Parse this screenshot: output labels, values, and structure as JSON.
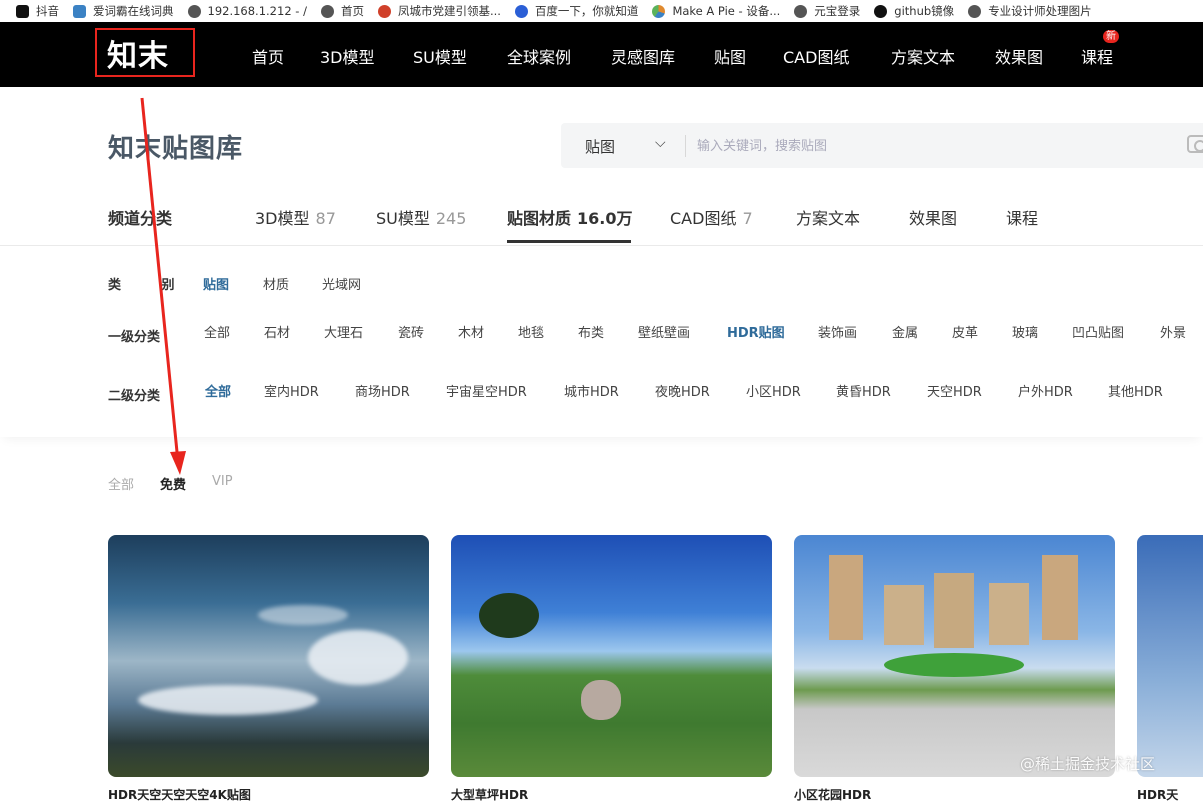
{
  "bookmarks": [
    {
      "label": "抖音",
      "color": "#111111"
    },
    {
      "label": "爱词霸在线词典",
      "color": "#3b82c4"
    },
    {
      "label": "192.168.1.212 - /",
      "color": "#333333"
    },
    {
      "label": "首页",
      "color": "#444444"
    },
    {
      "label": "凤城市党建引领基...",
      "color": "#d0402a"
    },
    {
      "label": "百度一下，你就知道",
      "color": "#2b5fd6"
    },
    {
      "label": "Make A Pie - 设备...",
      "color": "#e08a2f"
    },
    {
      "label": "元宝登录",
      "color": "#444444"
    },
    {
      "label": "github镜像",
      "color": "#111111"
    },
    {
      "label": "专业设计师处理图片",
      "color": "#555555"
    }
  ],
  "navbar": {
    "logo": "知末",
    "items": [
      "首页",
      "3D模型",
      "SU模型",
      "全球案例",
      "灵感图库",
      "贴图",
      "CAD图纸",
      "方案文本",
      "效果图",
      "课程"
    ],
    "badge": "新"
  },
  "page": {
    "title": "知末贴图库"
  },
  "search": {
    "type": "贴图",
    "placeholder": "输入关键词，搜索贴图"
  },
  "channels": {
    "label": "频道分类",
    "items": [
      {
        "name": "3D模型",
        "count": "87"
      },
      {
        "name": "SU模型",
        "count": "245"
      },
      {
        "name": "贴图材质",
        "count": "16.0万"
      },
      {
        "name": "CAD图纸",
        "count": "7"
      },
      {
        "name": "方案文本",
        "count": ""
      },
      {
        "name": "效果图",
        "count": ""
      },
      {
        "name": "课程",
        "count": ""
      }
    ]
  },
  "filters": {
    "category": {
      "label": "类 别",
      "items": [
        "贴图",
        "材质",
        "光域网"
      ]
    },
    "level1": {
      "label": "一级分类",
      "items": [
        "全部",
        "石材",
        "大理石",
        "瓷砖",
        "木材",
        "地毯",
        "布类",
        "壁纸壁画",
        "HDR贴图",
        "装饰画",
        "金属",
        "皮革",
        "玻璃",
        "凹凸贴图",
        "外景"
      ]
    },
    "level2": {
      "label": "二级分类",
      "items": [
        "全部",
        "室内HDR",
        "商场HDR",
        "宇宙星空HDR",
        "城市HDR",
        "夜晚HDR",
        "小区HDR",
        "黄昏HDR",
        "天空HDR",
        "户外HDR",
        "其他HDR"
      ]
    }
  },
  "pricing": [
    "全部",
    "免费",
    "VIP"
  ],
  "cards": [
    {
      "title": "HDR天空天空天空4K贴图"
    },
    {
      "title": "大型草坪HDR"
    },
    {
      "title": "小区花园HDR"
    },
    {
      "title": "HDR天"
    }
  ],
  "watermark": "@稀土掘金技术社区"
}
